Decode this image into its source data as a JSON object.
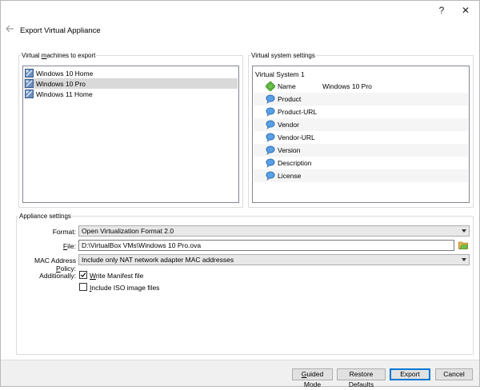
{
  "window": {
    "help_glyph": "?",
    "close_glyph": "✕",
    "title": "Export Virtual Appliance"
  },
  "vms": {
    "legend_pre": "Virtual ",
    "legend_mn": "m",
    "legend_post": "achines to export",
    "items": [
      {
        "label": "Windows 10 Home",
        "selected": false
      },
      {
        "label": "Windows 10 Pro",
        "selected": true
      },
      {
        "label": "Windows 11 Home",
        "selected": false
      }
    ]
  },
  "system": {
    "legend": "Virtual system settings",
    "root": "Virtual System 1",
    "rows": [
      {
        "key": "Name",
        "value": "Windows 10 Pro",
        "icon": "name-icon"
      },
      {
        "key": "Product",
        "value": "",
        "icon": "speech-bubble-icon"
      },
      {
        "key": "Product-URL",
        "value": "",
        "icon": "speech-bubble-icon"
      },
      {
        "key": "Vendor",
        "value": "",
        "icon": "speech-bubble-icon"
      },
      {
        "key": "Vendor-URL",
        "value": "",
        "icon": "speech-bubble-icon"
      },
      {
        "key": "Version",
        "value": "",
        "icon": "speech-bubble-icon"
      },
      {
        "key": "Description",
        "value": "",
        "icon": "speech-bubble-icon"
      },
      {
        "key": "License",
        "value": "",
        "icon": "speech-bubble-icon"
      }
    ]
  },
  "appliance": {
    "legend": "Appliance settings",
    "format_label": "Format:",
    "format_value": "Open Virtualization Format 2.0",
    "file_label_mn": "F",
    "file_label_post": "ile:",
    "file_value": "D:\\VirtualBox VMs\\Windows 10 Pro.ova",
    "mac_label_pre": "MAC Address ",
    "mac_label_mn": "P",
    "mac_label_post": "olicy:",
    "mac_value": "Include only NAT network adapter MAC addresses",
    "additionally_label": "Additionally:",
    "manifest_mn": "W",
    "manifest_post": "rite Manifest file",
    "manifest_checked": true,
    "iso_pre": "",
    "iso_mn": "I",
    "iso_post": "nclude ISO image files",
    "iso_checked": false
  },
  "buttons": {
    "guided_mn": "G",
    "guided_post": "uided Mode",
    "restore": "Restore Defaults",
    "export": "Export",
    "cancel": "Cancel"
  },
  "colors": {
    "selection": "#d9d9d9",
    "default_button_border": "#0078d7",
    "footer_bg": "#f0f0f0"
  }
}
